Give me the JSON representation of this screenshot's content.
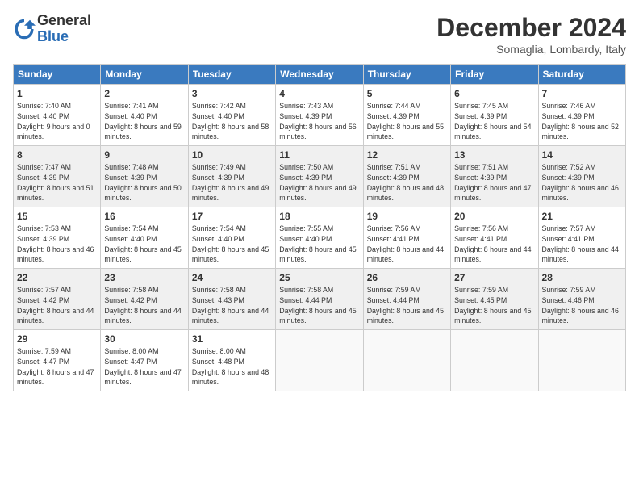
{
  "logo": {
    "general": "General",
    "blue": "Blue"
  },
  "title": "December 2024",
  "location": "Somaglia, Lombardy, Italy",
  "headers": [
    "Sunday",
    "Monday",
    "Tuesday",
    "Wednesday",
    "Thursday",
    "Friday",
    "Saturday"
  ],
  "weeks": [
    [
      {
        "day": "1",
        "sunrise": "7:40 AM",
        "sunset": "4:40 PM",
        "daylight": "9 hours and 0 minutes."
      },
      {
        "day": "2",
        "sunrise": "7:41 AM",
        "sunset": "4:40 PM",
        "daylight": "8 hours and 59 minutes."
      },
      {
        "day": "3",
        "sunrise": "7:42 AM",
        "sunset": "4:40 PM",
        "daylight": "8 hours and 58 minutes."
      },
      {
        "day": "4",
        "sunrise": "7:43 AM",
        "sunset": "4:39 PM",
        "daylight": "8 hours and 56 minutes."
      },
      {
        "day": "5",
        "sunrise": "7:44 AM",
        "sunset": "4:39 PM",
        "daylight": "8 hours and 55 minutes."
      },
      {
        "day": "6",
        "sunrise": "7:45 AM",
        "sunset": "4:39 PM",
        "daylight": "8 hours and 54 minutes."
      },
      {
        "day": "7",
        "sunrise": "7:46 AM",
        "sunset": "4:39 PM",
        "daylight": "8 hours and 52 minutes."
      }
    ],
    [
      {
        "day": "8",
        "sunrise": "7:47 AM",
        "sunset": "4:39 PM",
        "daylight": "8 hours and 51 minutes."
      },
      {
        "day": "9",
        "sunrise": "7:48 AM",
        "sunset": "4:39 PM",
        "daylight": "8 hours and 50 minutes."
      },
      {
        "day": "10",
        "sunrise": "7:49 AM",
        "sunset": "4:39 PM",
        "daylight": "8 hours and 49 minutes."
      },
      {
        "day": "11",
        "sunrise": "7:50 AM",
        "sunset": "4:39 PM",
        "daylight": "8 hours and 49 minutes."
      },
      {
        "day": "12",
        "sunrise": "7:51 AM",
        "sunset": "4:39 PM",
        "daylight": "8 hours and 48 minutes."
      },
      {
        "day": "13",
        "sunrise": "7:51 AM",
        "sunset": "4:39 PM",
        "daylight": "8 hours and 47 minutes."
      },
      {
        "day": "14",
        "sunrise": "7:52 AM",
        "sunset": "4:39 PM",
        "daylight": "8 hours and 46 minutes."
      }
    ],
    [
      {
        "day": "15",
        "sunrise": "7:53 AM",
        "sunset": "4:39 PM",
        "daylight": "8 hours and 46 minutes."
      },
      {
        "day": "16",
        "sunrise": "7:54 AM",
        "sunset": "4:40 PM",
        "daylight": "8 hours and 45 minutes."
      },
      {
        "day": "17",
        "sunrise": "7:54 AM",
        "sunset": "4:40 PM",
        "daylight": "8 hours and 45 minutes."
      },
      {
        "day": "18",
        "sunrise": "7:55 AM",
        "sunset": "4:40 PM",
        "daylight": "8 hours and 45 minutes."
      },
      {
        "day": "19",
        "sunrise": "7:56 AM",
        "sunset": "4:41 PM",
        "daylight": "8 hours and 44 minutes."
      },
      {
        "day": "20",
        "sunrise": "7:56 AM",
        "sunset": "4:41 PM",
        "daylight": "8 hours and 44 minutes."
      },
      {
        "day": "21",
        "sunrise": "7:57 AM",
        "sunset": "4:41 PM",
        "daylight": "8 hours and 44 minutes."
      }
    ],
    [
      {
        "day": "22",
        "sunrise": "7:57 AM",
        "sunset": "4:42 PM",
        "daylight": "8 hours and 44 minutes."
      },
      {
        "day": "23",
        "sunrise": "7:58 AM",
        "sunset": "4:42 PM",
        "daylight": "8 hours and 44 minutes."
      },
      {
        "day": "24",
        "sunrise": "7:58 AM",
        "sunset": "4:43 PM",
        "daylight": "8 hours and 44 minutes."
      },
      {
        "day": "25",
        "sunrise": "7:58 AM",
        "sunset": "4:44 PM",
        "daylight": "8 hours and 45 minutes."
      },
      {
        "day": "26",
        "sunrise": "7:59 AM",
        "sunset": "4:44 PM",
        "daylight": "8 hours and 45 minutes."
      },
      {
        "day": "27",
        "sunrise": "7:59 AM",
        "sunset": "4:45 PM",
        "daylight": "8 hours and 45 minutes."
      },
      {
        "day": "28",
        "sunrise": "7:59 AM",
        "sunset": "4:46 PM",
        "daylight": "8 hours and 46 minutes."
      }
    ],
    [
      {
        "day": "29",
        "sunrise": "7:59 AM",
        "sunset": "4:47 PM",
        "daylight": "8 hours and 47 minutes."
      },
      {
        "day": "30",
        "sunrise": "8:00 AM",
        "sunset": "4:47 PM",
        "daylight": "8 hours and 47 minutes."
      },
      {
        "day": "31",
        "sunrise": "8:00 AM",
        "sunset": "4:48 PM",
        "daylight": "8 hours and 48 minutes."
      },
      null,
      null,
      null,
      null
    ]
  ]
}
